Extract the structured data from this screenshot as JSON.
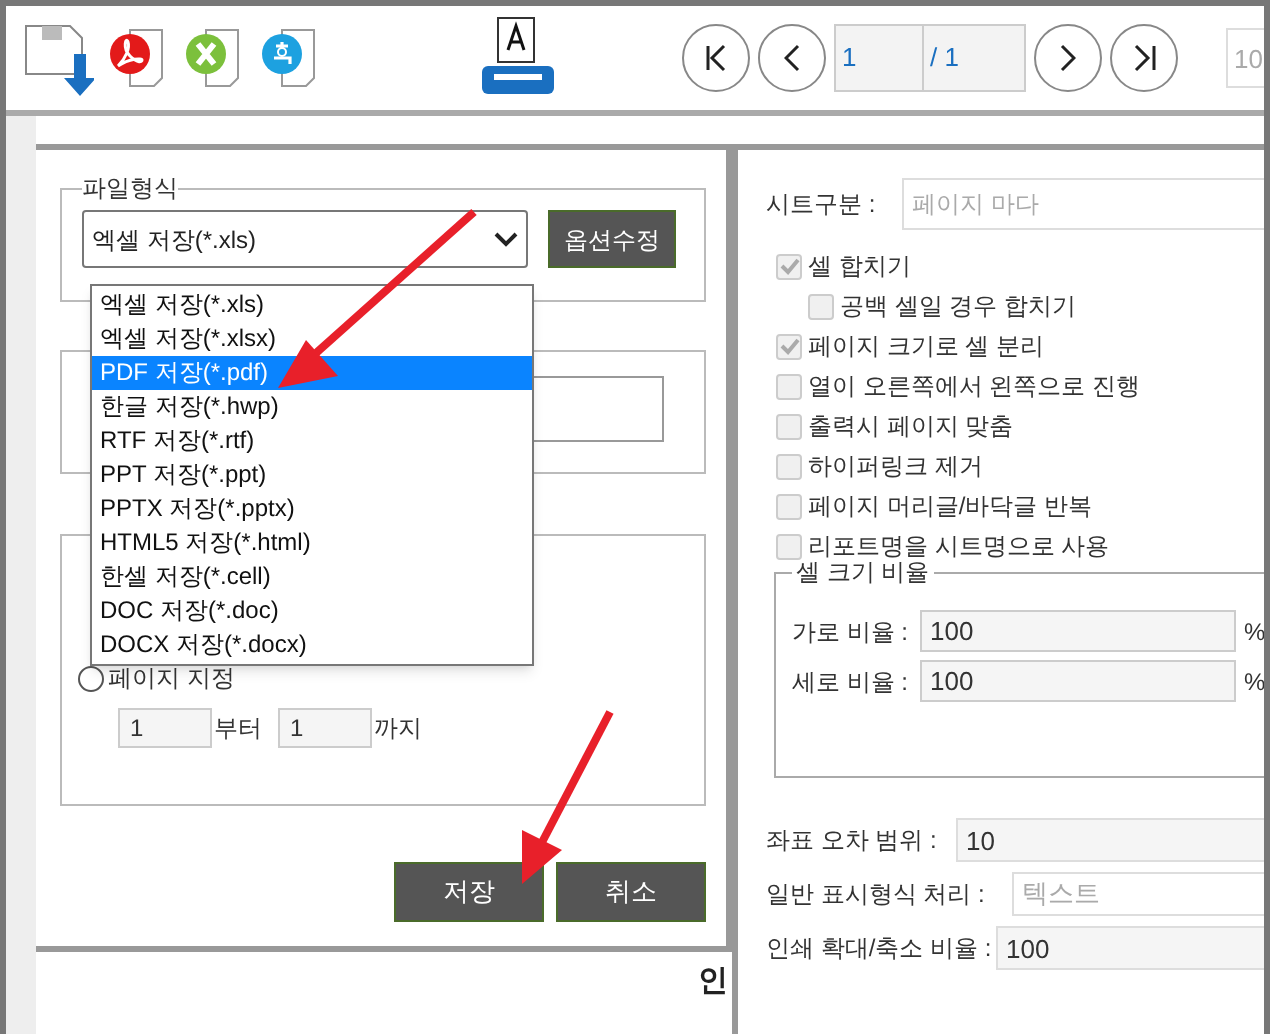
{
  "toolbar": {
    "page_input": "1",
    "page_total": "/ 1",
    "zoom_input": "10"
  },
  "file_format": {
    "legend": "파일형식",
    "select_value": "엑셀 저장(*.xls)",
    "option_button": "옵션수정",
    "dropdown_open": true,
    "options": [
      {
        "label": "엑셀 저장(*.xls)",
        "selected": false
      },
      {
        "label": "엑셀 저장(*.xlsx)",
        "selected": false
      },
      {
        "label": "PDF 저장(*.pdf)",
        "selected": true
      },
      {
        "label": "한글 저장(*.hwp)",
        "selected": false
      },
      {
        "label": "RTF 저장(*.rtf)",
        "selected": false
      },
      {
        "label": "PPT 저장(*.ppt)",
        "selected": false
      },
      {
        "label": "PPTX 저장(*.pptx)",
        "selected": false
      },
      {
        "label": "HTML5 저장(*.html)",
        "selected": false
      },
      {
        "label": "한셀 저장(*.cell)",
        "selected": false
      },
      {
        "label": "DOC 저장(*.doc)",
        "selected": false
      },
      {
        "label": "DOCX 저장(*.docx)",
        "selected": false
      }
    ]
  },
  "range": {
    "radios": [
      {
        "label": "페이지 지정",
        "selected": false
      }
    ],
    "from": "1",
    "from_suffix": "부터",
    "to": "1",
    "to_suffix": "까지"
  },
  "buttons": [
    "저장",
    "취소"
  ],
  "page_text": "인",
  "options_panel": {
    "sheet_split": {
      "label": "시트구분 :",
      "value": "페이지 마다"
    },
    "checkboxes": [
      {
        "label": "셀 합치기",
        "checked": true,
        "children": [
          {
            "label": "공백 셀일 경우 합치기",
            "checked": false
          }
        ]
      },
      {
        "label": "페이지 크기로 셀 분리",
        "checked": true
      },
      {
        "label": "열이 오른쪽에서 왼쪽으로 진행",
        "checked": false
      },
      {
        "label": "출력시 페이지 맞춤",
        "checked": false
      },
      {
        "label": "하이퍼링크 제거",
        "checked": false
      },
      {
        "label": "페이지 머리글/바닥글 반복",
        "checked": false
      },
      {
        "label": "리포트명을 시트명으로 사용",
        "checked": false
      }
    ],
    "cell_ratio": {
      "legend": "셀 크기 비율",
      "rows": [
        {
          "label": "가로 비율 :",
          "value": "100",
          "unit": "%"
        },
        {
          "label": "세로 비율 :",
          "value": "100",
          "unit": "%"
        }
      ]
    },
    "fields": [
      {
        "label": "좌표 오차 범위 :",
        "value": "10",
        "disabled": false
      },
      {
        "label": "일반 표시형식 처리 :",
        "value": "텍스트",
        "disabled": true
      },
      {
        "label": "인쇄 확대/축소 비율 :",
        "value": "100",
        "disabled": false
      }
    ]
  }
}
